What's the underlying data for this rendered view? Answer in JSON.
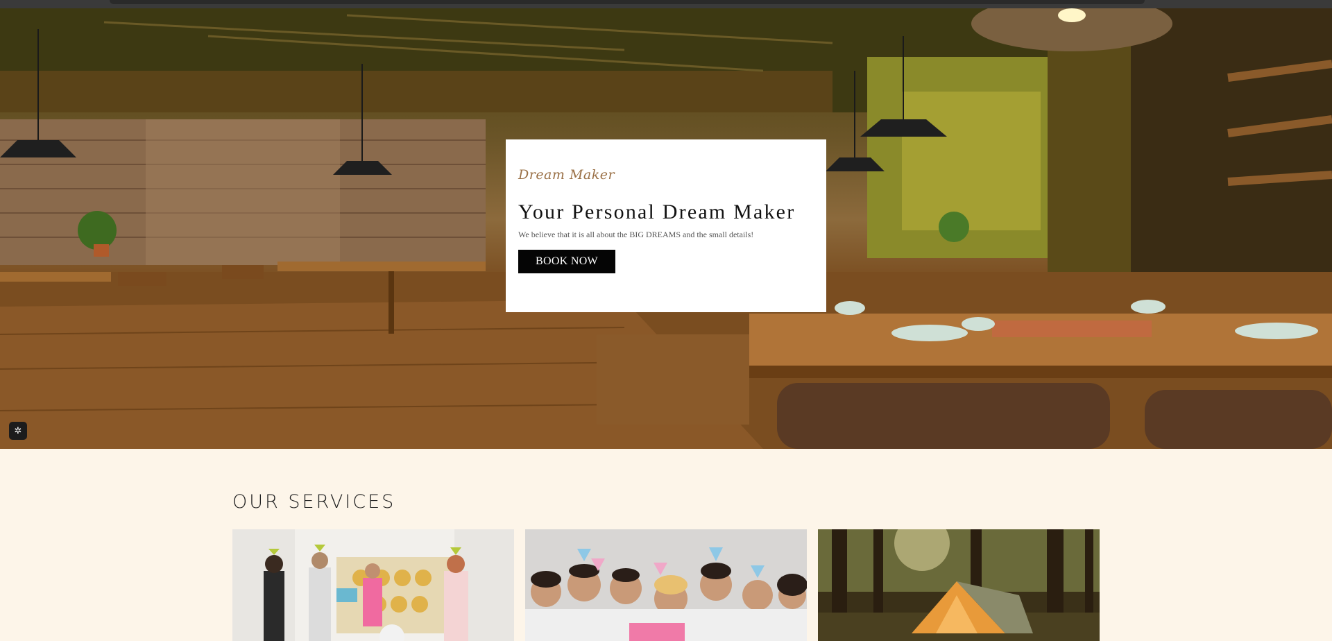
{
  "hero": {
    "brand": "Dream Maker",
    "headline": "Your Personal Dream Maker",
    "tagline": "We believe that it is all about the BIG DREAMS and the small details!",
    "cta_label": "BOOK NOW"
  },
  "services": {
    "title": "OUR SERVICES",
    "cards": [
      {
        "image": "birthday-party-photo"
      },
      {
        "image": "party-celebration-photo"
      },
      {
        "image": "forest-camping-photo"
      }
    ]
  },
  "icons": {
    "accessibility": "accessibility-icon"
  },
  "colors": {
    "page_bg": "#fdf5e9",
    "cta_bg": "#050505",
    "brand": "#9a7046"
  }
}
